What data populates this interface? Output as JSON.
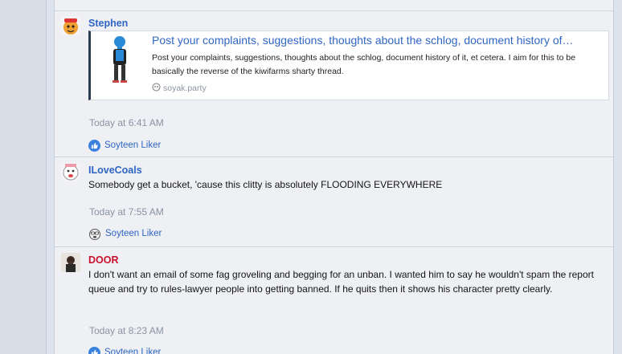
{
  "posts": [
    {
      "author": "Stephen",
      "embed": {
        "title": "Post your complaints, suggestions, thoughts about the schlog, document history of…",
        "description": "Post your complaints, suggestions, thoughts about the schlog, document history of it, et cetera. I aim for this to be basically the reverse of the kiwifarms sharty thread.",
        "source": "soyak.party",
        "thumb_icon": "blue-figure-icon"
      },
      "time": "Today at 6:41 AM",
      "reaction": {
        "label": "Soyteen Liker",
        "icon": "like-icon"
      }
    },
    {
      "author": "ILoveCoals",
      "message": "Somebody get a bucket, 'cause this clitty is absolutely FLOODING EVERYWHERE",
      "time": "Today at 7:55 AM",
      "reaction": {
        "label": "Soyteen Liker",
        "icon": "soyjak-icon"
      }
    },
    {
      "author": "DOOR",
      "message": "I don't want an email of some fag groveling and begging for an unban. I wanted him to say he wouldn't spam the report queue and try to rules-lawyer people into getting banned. If he quits then it shows his character pretty clearly.",
      "time": "Today at 8:23 AM",
      "reaction": {
        "label": "Soyteen Liker",
        "icon": "like-icon"
      }
    }
  ],
  "colors": {
    "link": "#2f66c4",
    "admin_name": "#c8102e",
    "timestamp": "#8a93a3",
    "embed_border": "#2b3a55"
  }
}
